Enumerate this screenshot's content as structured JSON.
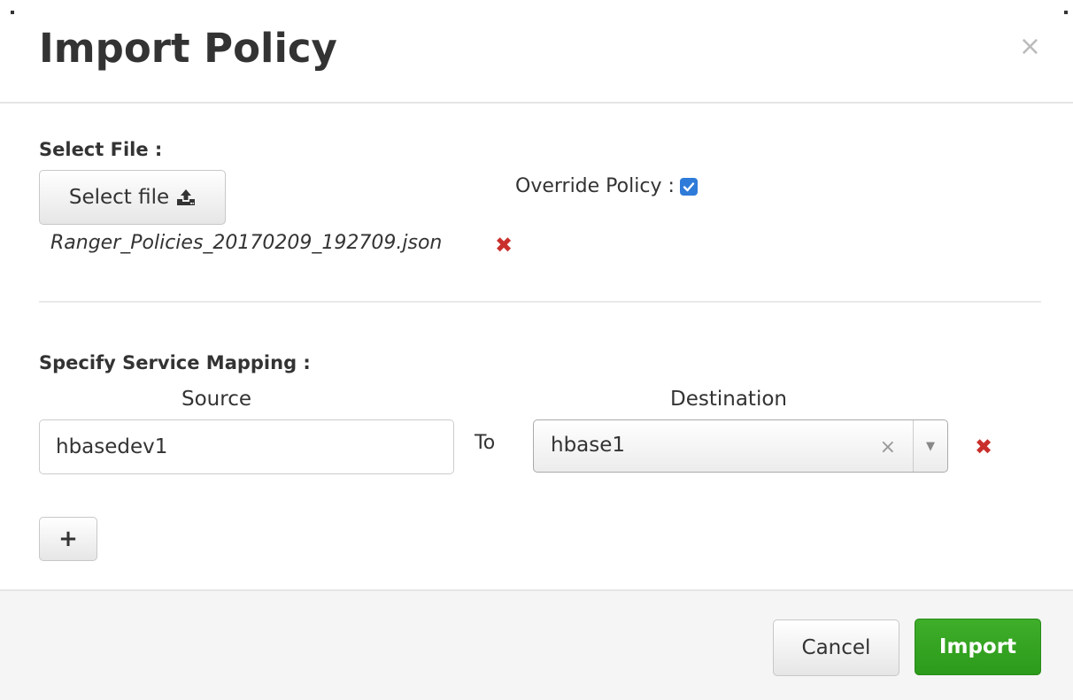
{
  "dialog": {
    "title": "Import Policy",
    "close_glyph": "×"
  },
  "file_section": {
    "label": "Select File :",
    "select_button_label": "Select file",
    "select_button_icon": "upload-icon",
    "selected_filename": "Ranger_Policies_20170209_192709.json",
    "remove_glyph": "✖"
  },
  "override": {
    "label": "Override Policy :",
    "checked": true
  },
  "mapping": {
    "label": "Specify Service Mapping :",
    "source_header": "Source",
    "destination_header": "Destination",
    "to_label": "To",
    "rows": [
      {
        "source": "hbasedev1",
        "destination": "hbase1"
      }
    ],
    "clear_glyph": "×",
    "remove_glyph": "✖",
    "add_button_label": "+"
  },
  "footer": {
    "cancel_label": "Cancel",
    "import_label": "Import"
  },
  "colors": {
    "import_button": "#36a421",
    "remove_icon": "#c9302c",
    "checkbox": "#2f7bd9"
  }
}
